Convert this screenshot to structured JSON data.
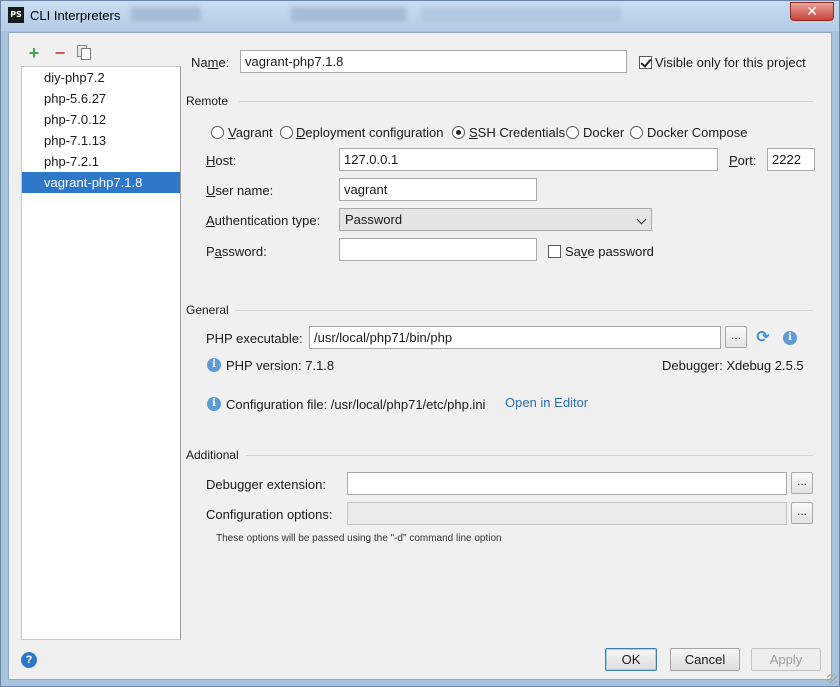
{
  "window": {
    "title": "CLI Interpreters",
    "app_icon": "PS",
    "close_glyph": "✕"
  },
  "toolbar": {
    "add_glyph": "+",
    "remove_glyph": "−"
  },
  "interpreters": [
    {
      "label": "diy-php7.2"
    },
    {
      "label": "php-5.6.27"
    },
    {
      "label": "php-7.0.12"
    },
    {
      "label": "php-7.1.13"
    },
    {
      "label": "php-7.2.1"
    },
    {
      "label": "vagrant-php7.1.8",
      "selected": true
    }
  ],
  "name": {
    "label_pre": "Na",
    "label_key": "m",
    "label_post": "e:",
    "value": "vagrant-php7.1.8"
  },
  "visible_only": {
    "label": "Visible only for this project",
    "checked": true
  },
  "remote": {
    "section_title": "Remote",
    "options": {
      "vagrant": {
        "key": "V",
        "rest": "agrant"
      },
      "deployment": {
        "key": "D",
        "rest": "eployment configuration"
      },
      "ssh": {
        "key": "S",
        "rest": "SH Credentials"
      },
      "docker": "Docker",
      "docker_compose": "Docker Compose"
    },
    "selected": "ssh",
    "host": {
      "label_key": "H",
      "label_rest": "ost:",
      "value": "127.0.0.1"
    },
    "port": {
      "label_key": "P",
      "label_rest": "ort:",
      "value": "2222"
    },
    "username": {
      "label_key": "U",
      "label_rest": "ser name:",
      "value": "vagrant"
    },
    "auth_type": {
      "label_key": "A",
      "label_rest": "uthentication type:",
      "value": "Password"
    },
    "password": {
      "label_pre": "P",
      "label_key": "a",
      "label_rest": "ssword:",
      "value": ""
    },
    "save_password": {
      "label_pre": "Sa",
      "label_key": "v",
      "label_rest": "e password",
      "checked": false
    }
  },
  "general": {
    "section_title": "General",
    "php_exec_label": "PHP executable:",
    "php_exec_value": "/usr/local/php71/bin/php",
    "browse_label": "...",
    "php_version": "PHP version: 7.1.8",
    "debugger": "Debugger: Xdebug 2.5.5",
    "config_file": "Configuration file: /usr/local/php71/etc/php.ini",
    "open_in_editor": "Open in Editor",
    "info_glyph": "i",
    "reload_glyph": "⟳"
  },
  "additional": {
    "section_title": "Additional",
    "debugger_ext_label": "Debugger extension:",
    "debugger_ext_value": "",
    "config_options_label": "Configuration options:",
    "config_options_value": "",
    "browse_label": "...",
    "hint": "These options will be passed using the \"-d\" command line option"
  },
  "buttons": {
    "ok": "OK",
    "cancel": "Cancel",
    "apply": "Apply",
    "help_glyph": "?"
  }
}
